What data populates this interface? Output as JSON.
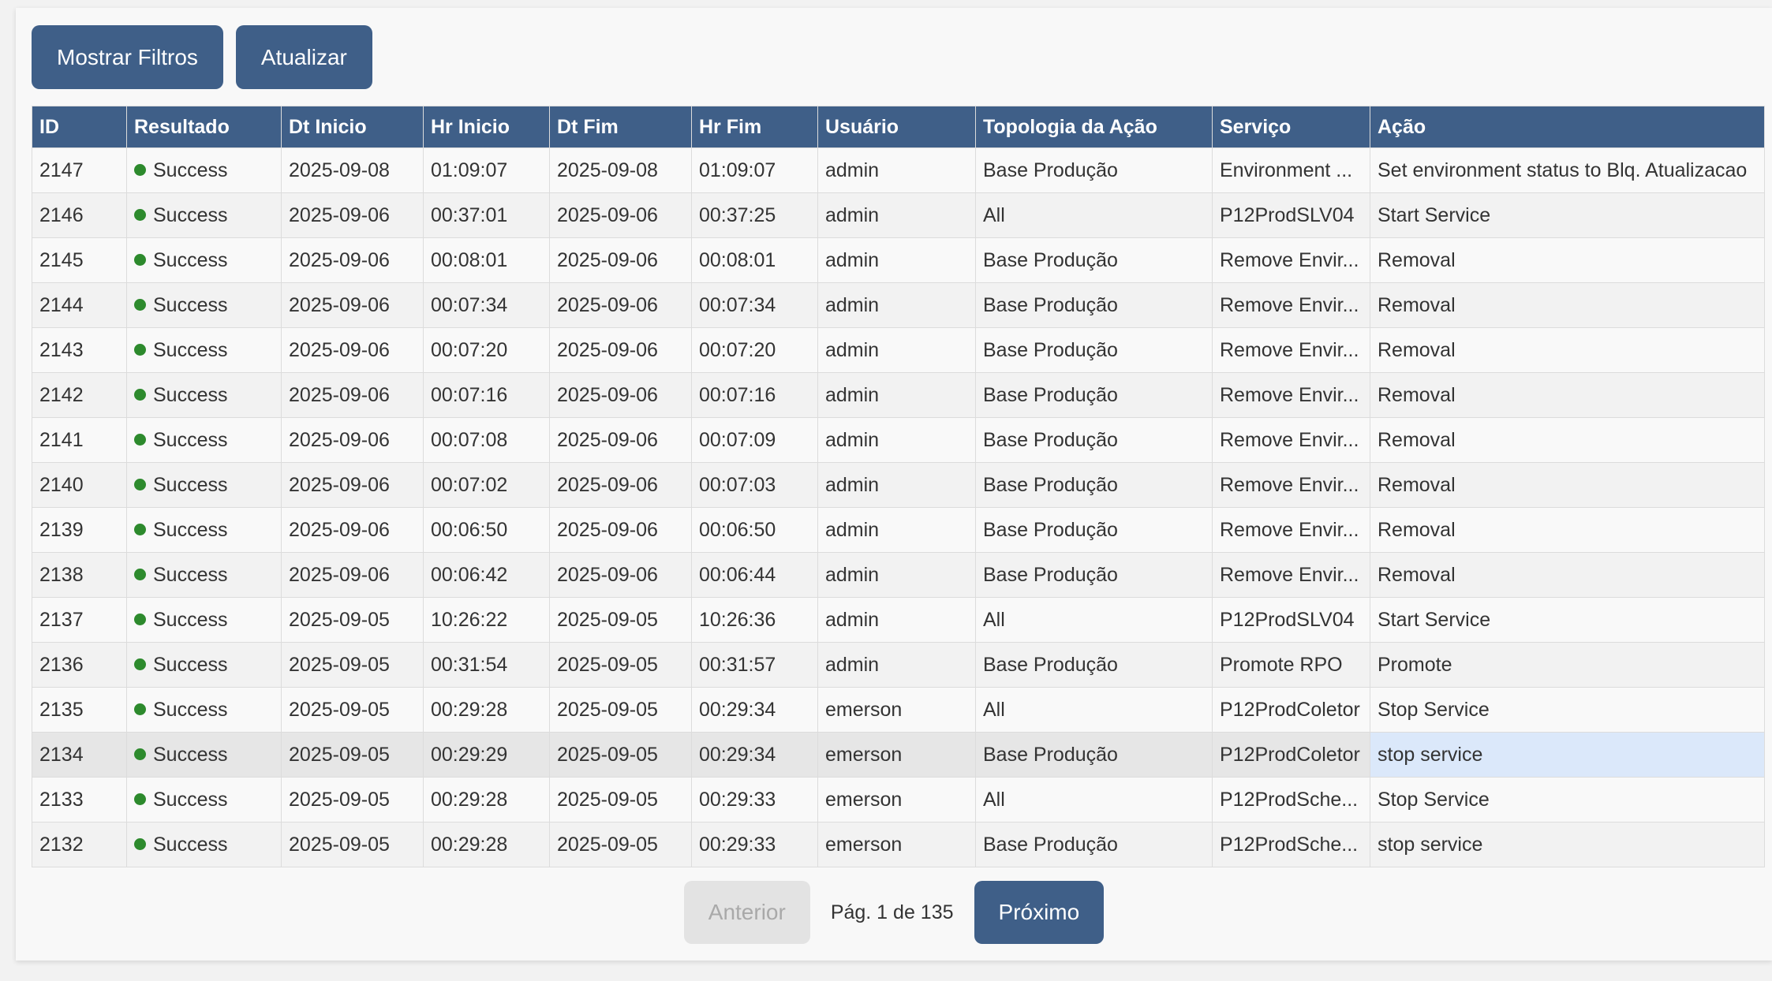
{
  "toolbar": {
    "filters_label": "Mostrar Filtros",
    "refresh_label": "Atualizar"
  },
  "table": {
    "columns": [
      "ID",
      "Resultado",
      "Dt Inicio",
      "Hr Inicio",
      "Dt Fim",
      "Hr Fim",
      "Usuário",
      "Topologia da Ação",
      "Serviço",
      "Ação"
    ],
    "status_color": "#2d8a2d",
    "rows": [
      {
        "id": "2147",
        "resultado": "Success",
        "dt_inicio": "2025-09-08",
        "hr_inicio": "01:09:07",
        "dt_fim": "2025-09-08",
        "hr_fim": "01:09:07",
        "usuario": "admin",
        "topologia": "Base Produção",
        "servico": "Environment ...",
        "acao": "Set environment status to Blq. Atualizacao"
      },
      {
        "id": "2146",
        "resultado": "Success",
        "dt_inicio": "2025-09-06",
        "hr_inicio": "00:37:01",
        "dt_fim": "2025-09-06",
        "hr_fim": "00:37:25",
        "usuario": "admin",
        "topologia": "All",
        "servico": "P12ProdSLV04",
        "acao": "Start Service"
      },
      {
        "id": "2145",
        "resultado": "Success",
        "dt_inicio": "2025-09-06",
        "hr_inicio": "00:08:01",
        "dt_fim": "2025-09-06",
        "hr_fim": "00:08:01",
        "usuario": "admin",
        "topologia": "Base Produção",
        "servico": "Remove Envir...",
        "acao": "Removal"
      },
      {
        "id": "2144",
        "resultado": "Success",
        "dt_inicio": "2025-09-06",
        "hr_inicio": "00:07:34",
        "dt_fim": "2025-09-06",
        "hr_fim": "00:07:34",
        "usuario": "admin",
        "topologia": "Base Produção",
        "servico": "Remove Envir...",
        "acao": "Removal"
      },
      {
        "id": "2143",
        "resultado": "Success",
        "dt_inicio": "2025-09-06",
        "hr_inicio": "00:07:20",
        "dt_fim": "2025-09-06",
        "hr_fim": "00:07:20",
        "usuario": "admin",
        "topologia": "Base Produção",
        "servico": "Remove Envir...",
        "acao": "Removal"
      },
      {
        "id": "2142",
        "resultado": "Success",
        "dt_inicio": "2025-09-06",
        "hr_inicio": "00:07:16",
        "dt_fim": "2025-09-06",
        "hr_fim": "00:07:16",
        "usuario": "admin",
        "topologia": "Base Produção",
        "servico": "Remove Envir...",
        "acao": "Removal"
      },
      {
        "id": "2141",
        "resultado": "Success",
        "dt_inicio": "2025-09-06",
        "hr_inicio": "00:07:08",
        "dt_fim": "2025-09-06",
        "hr_fim": "00:07:09",
        "usuario": "admin",
        "topologia": "Base Produção",
        "servico": "Remove Envir...",
        "acao": "Removal"
      },
      {
        "id": "2140",
        "resultado": "Success",
        "dt_inicio": "2025-09-06",
        "hr_inicio": "00:07:02",
        "dt_fim": "2025-09-06",
        "hr_fim": "00:07:03",
        "usuario": "admin",
        "topologia": "Base Produção",
        "servico": "Remove Envir...",
        "acao": "Removal"
      },
      {
        "id": "2139",
        "resultado": "Success",
        "dt_inicio": "2025-09-06",
        "hr_inicio": "00:06:50",
        "dt_fim": "2025-09-06",
        "hr_fim": "00:06:50",
        "usuario": "admin",
        "topologia": "Base Produção",
        "servico": "Remove Envir...",
        "acao": "Removal"
      },
      {
        "id": "2138",
        "resultado": "Success",
        "dt_inicio": "2025-09-06",
        "hr_inicio": "00:06:42",
        "dt_fim": "2025-09-06",
        "hr_fim": "00:06:44",
        "usuario": "admin",
        "topologia": "Base Produção",
        "servico": "Remove Envir...",
        "acao": "Removal"
      },
      {
        "id": "2137",
        "resultado": "Success",
        "dt_inicio": "2025-09-05",
        "hr_inicio": "10:26:22",
        "dt_fim": "2025-09-05",
        "hr_fim": "10:26:36",
        "usuario": "admin",
        "topologia": "All",
        "servico": "P12ProdSLV04",
        "acao": "Start Service"
      },
      {
        "id": "2136",
        "resultado": "Success",
        "dt_inicio": "2025-09-05",
        "hr_inicio": "00:31:54",
        "dt_fim": "2025-09-05",
        "hr_fim": "00:31:57",
        "usuario": "admin",
        "topologia": "Base Produção",
        "servico": "Promote RPO",
        "acao": "Promote"
      },
      {
        "id": "2135",
        "resultado": "Success",
        "dt_inicio": "2025-09-05",
        "hr_inicio": "00:29:28",
        "dt_fim": "2025-09-05",
        "hr_fim": "00:29:34",
        "usuario": "emerson",
        "topologia": "All",
        "servico": "P12ProdColetor",
        "acao": "Stop Service"
      },
      {
        "id": "2134",
        "resultado": "Success",
        "dt_inicio": "2025-09-05",
        "hr_inicio": "00:29:29",
        "dt_fim": "2025-09-05",
        "hr_fim": "00:29:34",
        "usuario": "emerson",
        "topologia": "Base Produção",
        "servico": "P12ProdColetor",
        "acao": "stop service"
      },
      {
        "id": "2133",
        "resultado": "Success",
        "dt_inicio": "2025-09-05",
        "hr_inicio": "00:29:28",
        "dt_fim": "2025-09-05",
        "hr_fim": "00:29:33",
        "usuario": "emerson",
        "topologia": "All",
        "servico": "P12ProdSche...",
        "acao": "Stop Service"
      },
      {
        "id": "2132",
        "resultado": "Success",
        "dt_inicio": "2025-09-05",
        "hr_inicio": "00:29:28",
        "dt_fim": "2025-09-05",
        "hr_fim": "00:29:33",
        "usuario": "emerson",
        "topologia": "Base Produção",
        "servico": "P12ProdSche...",
        "acao": "stop service"
      }
    ]
  },
  "pager": {
    "prev_label": "Anterior",
    "page_info": "Pág. 1 de 135",
    "next_label": "Próximo"
  }
}
